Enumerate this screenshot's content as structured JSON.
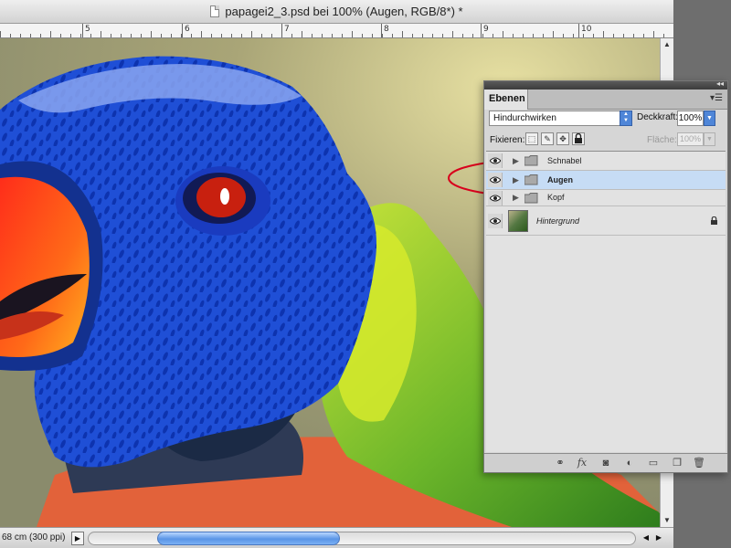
{
  "window": {
    "title": "papagei2_3.psd bei 100% (Augen, RGB/8*) *",
    "status_text": "68 cm (300 ppi)"
  },
  "ruler": {
    "labels": [
      "5",
      "6",
      "7",
      "8",
      "9",
      "10"
    ]
  },
  "panel": {
    "tab_label": "Ebenen",
    "blend_mode": "Hindurchwirken",
    "opacity_label": "Deckkraft:",
    "opacity_value": "100%",
    "lock_label": "Fixieren:",
    "fill_label": "Fläche:",
    "fill_value": "100%",
    "layers": [
      {
        "name": "Schnabel",
        "type": "group"
      },
      {
        "name": "Augen",
        "type": "group",
        "selected": true
      },
      {
        "name": "Kopf",
        "type": "group"
      },
      {
        "name": "Hintergrund",
        "type": "background",
        "locked": true
      }
    ]
  },
  "colors": {
    "selection": "#c6dcf5",
    "highlight_circle": "#d8001c",
    "scroll_thumb": "#5a95e6",
    "parrot_blue": "#1f4fd6",
    "beak": "#ff5a14"
  }
}
